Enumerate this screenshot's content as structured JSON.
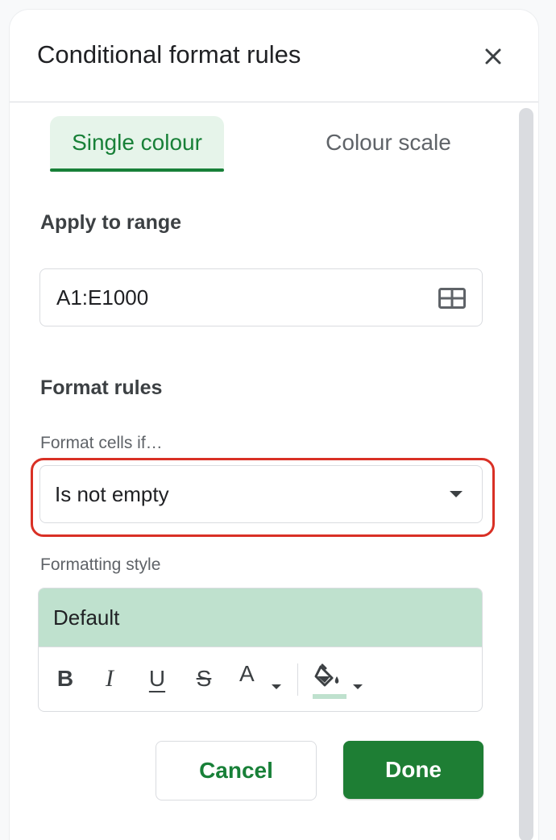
{
  "dialog": {
    "title": "Conditional format rules",
    "close_icon": "close-icon"
  },
  "tabs": [
    {
      "label": "Single colour",
      "active": true
    },
    {
      "label": "Colour scale",
      "active": false
    }
  ],
  "apply_range": {
    "heading": "Apply to range",
    "value": "A1:E1000",
    "icon": "grid-select-icon"
  },
  "format_rules": {
    "heading": "Format rules",
    "condition_label": "Format cells if…",
    "condition_value": "Is not empty"
  },
  "formatting_style": {
    "label": "Formatting style",
    "preview_text": "Default",
    "preview_color": "#bfe1ce",
    "toolbar": {
      "bold": "B",
      "italic": "I",
      "underline": "U",
      "strikethrough": "S",
      "text_color": "A"
    }
  },
  "buttons": {
    "cancel": "Cancel",
    "done": "Done"
  },
  "colors": {
    "accent": "#188038",
    "done_bg": "#1e7e34",
    "highlight": "#d93025"
  }
}
